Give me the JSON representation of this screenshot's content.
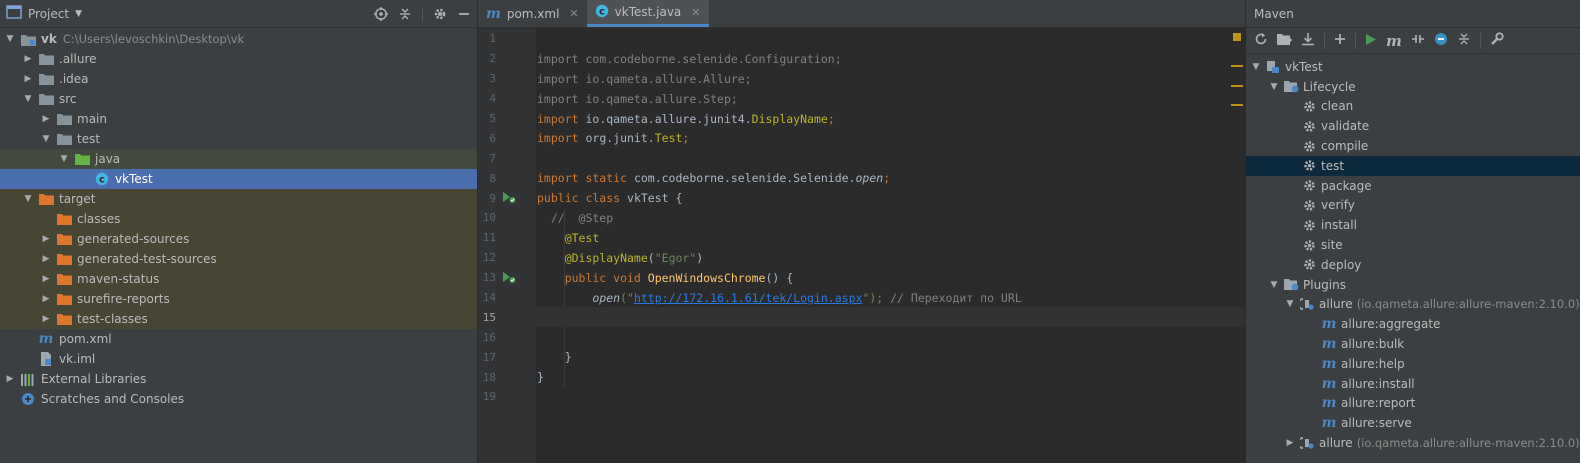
{
  "project_panel": {
    "title": "Project",
    "tree": [
      {
        "label": "vk",
        "path": "C:\\Users\\levoschkin\\Desktop\\vk",
        "depth": 0,
        "arrow": "down",
        "icon": "module-folder-icon"
      },
      {
        "label": ".allure",
        "depth": 1,
        "arrow": "right",
        "icon": "folder-icon"
      },
      {
        "label": ".idea",
        "depth": 1,
        "arrow": "right",
        "icon": "folder-icon"
      },
      {
        "label": "src",
        "depth": 1,
        "arrow": "down",
        "icon": "folder-icon"
      },
      {
        "label": "main",
        "depth": 2,
        "arrow": "right",
        "icon": "folder-icon"
      },
      {
        "label": "test",
        "depth": 2,
        "arrow": "down",
        "icon": "folder-icon"
      },
      {
        "label": "java",
        "depth": 3,
        "arrow": "down",
        "icon": "test-source-folder-icon"
      },
      {
        "label": "vkTest",
        "depth": 4,
        "arrow": "",
        "icon": "java-class-icon"
      },
      {
        "label": "target",
        "depth": 1,
        "arrow": "down",
        "icon": "excluded-folder-icon"
      },
      {
        "label": "classes",
        "depth": 2,
        "arrow": "",
        "icon": "excluded-folder-icon"
      },
      {
        "label": "generated-sources",
        "depth": 2,
        "arrow": "right",
        "icon": "excluded-folder-icon"
      },
      {
        "label": "generated-test-sources",
        "depth": 2,
        "arrow": "right",
        "icon": "excluded-folder-icon"
      },
      {
        "label": "maven-status",
        "depth": 2,
        "arrow": "right",
        "icon": "excluded-folder-icon"
      },
      {
        "label": "surefire-reports",
        "depth": 2,
        "arrow": "right",
        "icon": "excluded-folder-icon"
      },
      {
        "label": "test-classes",
        "depth": 2,
        "arrow": "right",
        "icon": "excluded-folder-icon"
      },
      {
        "label": "pom.xml",
        "depth": 1,
        "arrow": "",
        "icon": "maven-file-icon"
      },
      {
        "label": "vk.iml",
        "depth": 1,
        "arrow": "",
        "icon": "iml-file-icon"
      },
      {
        "label": "External Libraries",
        "depth": 0,
        "arrow": "right",
        "icon": "libraries-icon"
      },
      {
        "label": "Scratches and Consoles",
        "depth": 0,
        "arrow": "",
        "icon": "scratches-icon"
      }
    ]
  },
  "editor": {
    "tabs": [
      {
        "label": "pom.xml",
        "icon": "maven-file-icon"
      },
      {
        "label": "vkTest.java",
        "icon": "java-class-icon"
      }
    ],
    "line_numbers": [
      "1",
      "2",
      "3",
      "4",
      "5",
      "6",
      "7",
      "8",
      "9",
      "10",
      "11",
      "12",
      "13",
      "14",
      "15",
      "16",
      "17",
      "18",
      "19"
    ],
    "code": {
      "l2_a": "import ",
      "l2_b": "com.codeborne.selenide.Configuration;",
      "l3_a": "import ",
      "l3_b": "io.qameta.allure.Allure;",
      "l4_a": "import ",
      "l4_b": "io.qameta.allure.Step;",
      "l5_a": "import ",
      "l5_b": "io.qameta.allure.junit4.",
      "l5_c": "DisplayName",
      "l5_d": ";",
      "l6_a": "import ",
      "l6_b": "org.junit.",
      "l6_c": "Test",
      "l6_d": ";",
      "l8_a": "import static ",
      "l8_b": "com.codeborne.selenide.Selenide.",
      "l8_c": "open",
      "l8_d": ";",
      "l9_a": "public class ",
      "l9_b": "vkTest {",
      "l10": "  //  @Step",
      "l11": "    @Test",
      "l12_a": "    @DisplayName",
      "l12_b": "(",
      "l12_c": "\"Egor\"",
      "l12_d": ")",
      "l13_a": "    public void ",
      "l13_b": "OpenWindowsChrome",
      "l13_c": "() {",
      "l14_a": "        open",
      "l14_b": "(\"",
      "l14_c": "http://172.16.1.61/tek/Login.aspx",
      "l14_d": "\"); ",
      "l14_e": "// Переходит по URL",
      "l17": "    }",
      "l18": "}"
    }
  },
  "maven_panel": {
    "title": "Maven",
    "toolbar": [
      "reload-icon",
      "add-folder-icon",
      "download-icon",
      "plus-icon",
      "run-icon",
      "maven-m-icon",
      "toggle-offline-icon",
      "skip-tests-icon",
      "collapse-icon",
      "wrench-icon"
    ],
    "tree": [
      {
        "label": "vkTest",
        "depth": 0,
        "arrow": "down",
        "icon": "maven-project-icon"
      },
      {
        "label": "Lifecycle",
        "depth": 1,
        "arrow": "down",
        "icon": "lifecycle-folder-icon"
      },
      {
        "label": "clean",
        "depth": 2,
        "arrow": "",
        "icon": "gear-icon"
      },
      {
        "label": "validate",
        "depth": 2,
        "arrow": "",
        "icon": "gear-icon"
      },
      {
        "label": "compile",
        "depth": 2,
        "arrow": "",
        "icon": "gear-icon"
      },
      {
        "label": "test",
        "depth": 2,
        "arrow": "",
        "icon": "gear-icon",
        "selected": true
      },
      {
        "label": "package",
        "depth": 2,
        "arrow": "",
        "icon": "gear-icon"
      },
      {
        "label": "verify",
        "depth": 2,
        "arrow": "",
        "icon": "gear-icon"
      },
      {
        "label": "install",
        "depth": 2,
        "arrow": "",
        "icon": "gear-icon"
      },
      {
        "label": "site",
        "depth": 2,
        "arrow": "",
        "icon": "gear-icon"
      },
      {
        "label": "deploy",
        "depth": 2,
        "arrow": "",
        "icon": "gear-icon"
      },
      {
        "label": "Plugins",
        "depth": 1,
        "arrow": "down",
        "icon": "plugins-folder-icon"
      },
      {
        "label": "allure",
        "sub": "(io.qameta.allure:allure-maven:2.10.0)",
        "depth": 2,
        "arrow": "down",
        "icon": "plugin-icon"
      },
      {
        "label": "allure:aggregate",
        "depth": 3,
        "arrow": "",
        "icon": "maven-goal-icon"
      },
      {
        "label": "allure:bulk",
        "depth": 3,
        "arrow": "",
        "icon": "maven-goal-icon"
      },
      {
        "label": "allure:help",
        "depth": 3,
        "arrow": "",
        "icon": "maven-goal-icon"
      },
      {
        "label": "allure:install",
        "depth": 3,
        "arrow": "",
        "icon": "maven-goal-icon"
      },
      {
        "label": "allure:report",
        "depth": 3,
        "arrow": "",
        "icon": "maven-goal-icon"
      },
      {
        "label": "allure:serve",
        "depth": 3,
        "arrow": "",
        "icon": "maven-goal-icon"
      },
      {
        "label": "allure",
        "sub": "(io.qameta.allure:allure-maven:2.10.0)",
        "depth": 2,
        "arrow": "right",
        "icon": "plugin-icon"
      }
    ]
  }
}
